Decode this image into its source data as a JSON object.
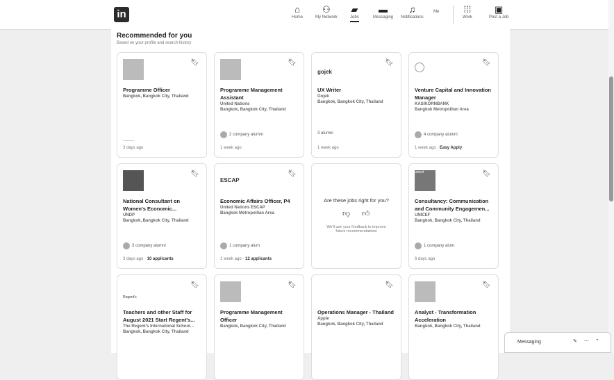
{
  "nav": {
    "home": "Home",
    "network": "My Network",
    "jobs": "Jobs",
    "messaging": "Messaging",
    "notifications": "Notifications",
    "me": "Me",
    "work": "Work",
    "post_job": "Post a Job"
  },
  "section": {
    "title": "Recommended for you",
    "subtitle": "Based on your profile and search history"
  },
  "cards": [
    {
      "title": "Programme Officer",
      "company": "",
      "location": "Bangkok, Bangkok City, Thailand",
      "alumni": "",
      "footer": "3 days ago",
      "applicants": ""
    },
    {
      "title": "Programme Management Assistant",
      "company": "United Nations",
      "location": "Bangkok, Bangkok City, Thailand",
      "alumni": "2 company alumni",
      "footer": "1 week ago",
      "applicants": ""
    },
    {
      "title": "UX Writer",
      "company": "Gojek",
      "location": "Bangkok, Bangkok City, Thailand",
      "alumni": "3 alumni",
      "footer": "1 week ago",
      "applicants": ""
    },
    {
      "title": "Venture Capital and Innovation Manager",
      "company": "KASIKORNBANK",
      "location": "Bangkok Metropolitan Area",
      "alumni": "4 company alumni",
      "footer": "1 week ago · ",
      "applicants": "Easy Apply"
    },
    {
      "title": "National Consultant on Women's Economic...",
      "company": "UNDP",
      "location": "Bangkok, Bangkok City, Thailand",
      "alumni": "3 company alumni",
      "footer": "3 days ago · ",
      "applicants": "10 applicants"
    },
    {
      "title": "Economic Affairs Officer, P4",
      "company": "United Nations ESCAP",
      "location": "Bangkok Metropolitan Area",
      "alumni": "1 company alum",
      "footer": "1 week ago · ",
      "applicants": "12 applicants"
    },
    {
      "title": "Consultancy: Communication and Community Engagemen...",
      "company": "UNICEF",
      "location": "Bangkok, Bangkok City, Thailand",
      "alumni": "1 company alum",
      "footer": "6 days ago",
      "applicants": ""
    },
    {
      "title": "Teachers and other Staff for August 2021 Start Regent's...",
      "company": "The Regent's International School...",
      "location": "Bangkok, Bangkok City, Thailand",
      "alumni": "",
      "footer": "",
      "applicants": ""
    },
    {
      "title": "Programme Management Officer",
      "company": "",
      "location": "Bangkok, Bangkok City, Thailand",
      "alumni": "",
      "footer": "",
      "applicants": ""
    },
    {
      "title": "Operations Manager - Thailand",
      "company": "Apple",
      "location": "Bangkok, Bangkok City, Thailand",
      "alumni": "",
      "footer": "",
      "applicants": ""
    },
    {
      "title": "Analyst - Transformation Acceleration",
      "company": "",
      "location": "Bangkok, Bangkok City, Thailand",
      "alumni": "",
      "footer": "",
      "applicants": ""
    }
  ],
  "logos": {
    "gojek": "gojek",
    "escap": "ESCAP",
    "unicef": "unicef",
    "regents": "Regent's"
  },
  "feedback": {
    "question": "Are these jobs right for you?",
    "note": "We'll use your feedback to improve future recommendations"
  },
  "messaging": {
    "label": "Messaging"
  },
  "icons": {
    "bookmark": "bookmark-icon",
    "thumbs_down": "thumbs-down-icon",
    "thumbs_up": "thumbs-up-icon"
  }
}
